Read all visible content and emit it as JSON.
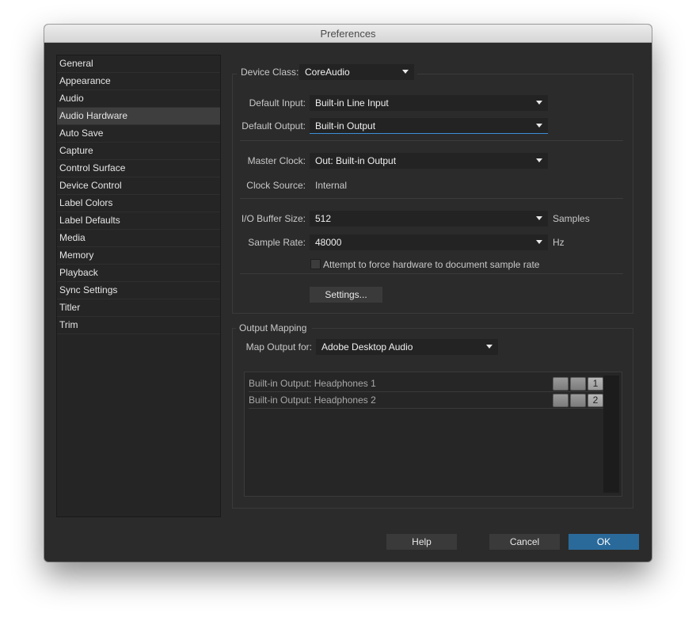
{
  "window": {
    "title": "Preferences"
  },
  "sidebar": {
    "selected_index": 3,
    "items": [
      {
        "label": "General"
      },
      {
        "label": "Appearance"
      },
      {
        "label": "Audio"
      },
      {
        "label": "Audio Hardware"
      },
      {
        "label": "Auto Save"
      },
      {
        "label": "Capture"
      },
      {
        "label": "Control Surface"
      },
      {
        "label": "Device Control"
      },
      {
        "label": "Label Colors"
      },
      {
        "label": "Label Defaults"
      },
      {
        "label": "Media"
      },
      {
        "label": "Memory"
      },
      {
        "label": "Playback"
      },
      {
        "label": "Sync Settings"
      },
      {
        "label": "Titler"
      },
      {
        "label": "Trim"
      }
    ]
  },
  "device": {
    "class_label": "Device Class:",
    "class_value": "CoreAudio",
    "default_input_label": "Default Input:",
    "default_input_value": "Built-in Line Input",
    "default_output_label": "Default Output:",
    "default_output_value": "Built-in Output",
    "master_clock_label": "Master Clock:",
    "master_clock_value": "Out: Built-in Output",
    "clock_source_label": "Clock Source:",
    "clock_source_value": "Internal",
    "buffer_label": "I/O Buffer Size:",
    "buffer_value": "512",
    "buffer_unit": "Samples",
    "sample_rate_label": "Sample Rate:",
    "sample_rate_value": "48000",
    "sample_rate_unit": "Hz",
    "force_rate_label": "Attempt to force hardware to document sample rate",
    "force_rate_checked": false,
    "settings_button": "Settings..."
  },
  "output_mapping": {
    "title": "Output Mapping",
    "map_for_label": "Map Output for:",
    "map_for_value": "Adobe Desktop Audio",
    "channels": [
      {
        "name": "Built-in Output: Headphones 1",
        "number": "1"
      },
      {
        "name": "Built-in Output: Headphones 2",
        "number": "2"
      }
    ]
  },
  "footer": {
    "help": "Help",
    "cancel": "Cancel",
    "ok": "OK"
  },
  "colors": {
    "window_bg": "#2b2b2b",
    "primary_button": "#2a6a9a",
    "focus_underline": "#3b8fd6"
  }
}
